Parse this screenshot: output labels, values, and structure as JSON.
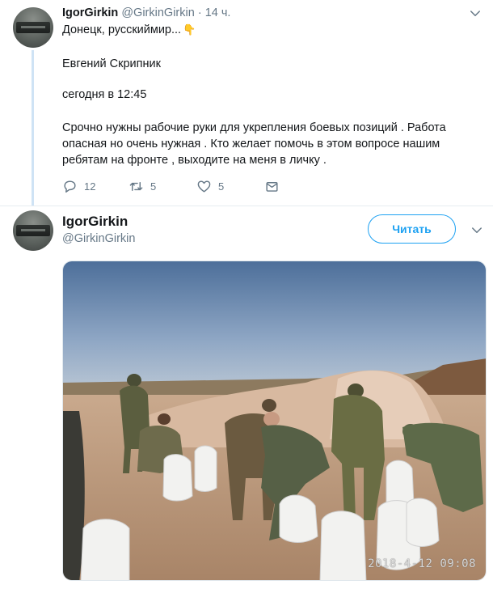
{
  "tweet1": {
    "author_name": "IgorGirkin",
    "author_handle": "@GirkinGirkin",
    "separator": "·",
    "time": "14 ч.",
    "line1": "Донецк, русскиймир...",
    "emoji": "👇",
    "line2": "Евгений Скрипник",
    "line3": "сегодня в 12:45",
    "body_lines": [
      "Срочно нужны рабочие руки для укрепления боевых позиций . Работа",
      "опасная но очень нужная . Кто желает помочь в этом вопросе нашим",
      "ребятам на фронте , выходите на меня в личку ."
    ],
    "actions": {
      "replies": "12",
      "retweets": "5",
      "likes": "5"
    },
    "icons": [
      "reply-icon",
      "retweet-icon",
      "like-icon",
      "direct-message-icon",
      "chevron-down-icon"
    ]
  },
  "tweet2": {
    "author_name": "IgorGirkin",
    "author_handle": "@GirkinGirkin",
    "follow_label": "Читать",
    "photo_timestamp": "2018-4-12 09:08"
  },
  "colors": {
    "accent": "#1da1f2",
    "muted": "#657786",
    "thread_line": "#cfe3f5",
    "text": "#14171a"
  }
}
